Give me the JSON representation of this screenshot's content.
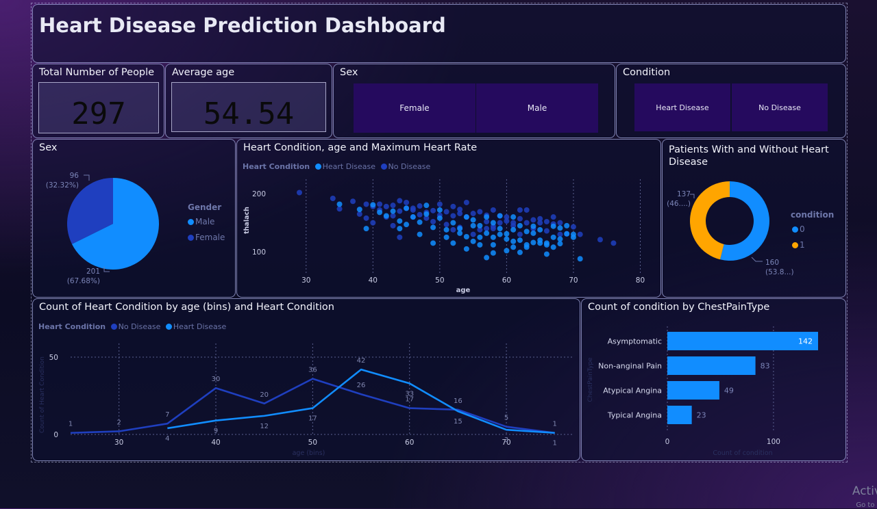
{
  "dashboard": {
    "title": "Heart Disease Prediction Dashboard"
  },
  "kpis": {
    "total_people": {
      "label": "Total Number of People",
      "value": "297"
    },
    "average_age": {
      "label": "Average age",
      "value": "54.54"
    }
  },
  "slicers": {
    "sex": {
      "label": "Sex",
      "options": [
        "Female",
        "Male"
      ]
    },
    "condition": {
      "label": "Condition",
      "options": [
        "Heart Disease",
        "No Disease"
      ]
    }
  },
  "colors": {
    "bright_blue": "#118dff",
    "dark_blue": "#1f3fbf",
    "orange": "#ffa500"
  },
  "watermark": {
    "line1": "Activ",
    "line2": "Go to S"
  },
  "chart_data": [
    {
      "type": "pie",
      "title": "Sex",
      "legend_title": "Gender",
      "legend": [
        "Male",
        "Female"
      ],
      "slices": [
        {
          "name": "Male",
          "value": 201,
          "label": "201",
          "pct": "(67.68%)",
          "color": "#118dff"
        },
        {
          "name": "Female",
          "value": 96,
          "label": "96",
          "pct": "(32.32%)",
          "color": "#1f3fbf"
        }
      ]
    },
    {
      "type": "scatter",
      "title": "Heart Condition, age and Maximum Heart Rate",
      "legend_title": "Heart Condition",
      "legend": [
        "Heart Disease",
        "No Disease"
      ],
      "xlabel": "age",
      "ylabel": "thalach",
      "xlim": [
        25,
        82
      ],
      "ylim": [
        60,
        225
      ],
      "xticks": [
        30,
        40,
        50,
        60,
        70,
        80
      ],
      "yticks": [
        100,
        200
      ],
      "series": [
        {
          "name": "Heart Disease",
          "color": "#118dff",
          "points": [
            [
              35,
              182
            ],
            [
              38,
              173
            ],
            [
              39,
              140
            ],
            [
              40,
              181
            ],
            [
              41,
              168
            ],
            [
              42,
              162
            ],
            [
              43,
              170
            ],
            [
              44,
              153
            ],
            [
              45,
              175
            ],
            [
              46,
              160
            ],
            [
              47,
              151
            ],
            [
              48,
              180
            ],
            [
              49,
              142
            ],
            [
              50,
              158
            ],
            [
              51,
              125
            ],
            [
              52,
              150
            ],
            [
              53,
              140
            ],
            [
              54,
              126
            ],
            [
              55,
              145
            ],
            [
              56,
              125
            ],
            [
              57,
              132
            ],
            [
              58,
              112
            ],
            [
              58,
              150
            ],
            [
              59,
              140
            ],
            [
              60,
              131
            ],
            [
              61,
              118
            ],
            [
              62,
              145
            ],
            [
              63,
              108
            ],
            [
              64,
              132
            ],
            [
              65,
              115
            ],
            [
              66,
              96
            ],
            [
              67,
              125
            ],
            [
              68,
              141
            ],
            [
              69,
              131
            ],
            [
              70,
              125
            ],
            [
              71,
              88
            ],
            [
              57,
              90
            ],
            [
              62,
              99
            ],
            [
              64,
              116
            ],
            [
              68,
              122
            ],
            [
              55,
              155
            ],
            [
              61,
              160
            ],
            [
              54,
              105
            ],
            [
              52,
              115
            ],
            [
              60,
              122
            ],
            [
              66,
              115
            ],
            [
              58,
              125
            ],
            [
              63,
              135
            ],
            [
              56,
              145
            ],
            [
              59,
              162
            ],
            [
              67,
              108
            ],
            [
              65,
              138
            ],
            [
              53,
              132
            ],
            [
              50,
              172
            ],
            [
              49,
              115
            ],
            [
              47,
              130
            ],
            [
              45,
              147
            ],
            [
              61,
              138
            ],
            [
              64,
              144
            ],
            [
              57,
              160
            ],
            [
              62,
              120
            ],
            [
              60,
              102
            ],
            [
              69,
              145
            ],
            [
              70,
              130
            ],
            [
              66,
              112
            ],
            [
              63,
              112
            ],
            [
              58,
              98
            ],
            [
              55,
              118
            ],
            [
              56,
              112
            ],
            [
              59,
              130
            ],
            [
              54,
              160
            ],
            [
              51,
              138
            ],
            [
              48,
              165
            ],
            [
              44,
              140
            ],
            [
              61,
              108
            ],
            [
              67,
              144
            ],
            [
              65,
              120
            ],
            [
              68,
              114
            ]
          ]
        },
        {
          "name": "No Disease",
          "color": "#1f3fbf",
          "points": [
            [
              29,
              202
            ],
            [
              34,
              192
            ],
            [
              35,
              174
            ],
            [
              37,
              187
            ],
            [
              38,
              165
            ],
            [
              39,
              182
            ],
            [
              40,
              178
            ],
            [
              41,
              172
            ],
            [
              42,
              178
            ],
            [
              43,
              162
            ],
            [
              44,
              188
            ],
            [
              45,
              175
            ],
            [
              46,
              172
            ],
            [
              47,
              179
            ],
            [
              48,
              168
            ],
            [
              49,
              171
            ],
            [
              50,
              163
            ],
            [
              51,
              169
            ],
            [
              52,
              162
            ],
            [
              53,
              173
            ],
            [
              54,
              160
            ],
            [
              55,
              166
            ],
            [
              56,
              169
            ],
            [
              57,
              163
            ],
            [
              58,
              172
            ],
            [
              59,
              162
            ],
            [
              60,
              153
            ],
            [
              61,
              150
            ],
            [
              62,
              157
            ],
            [
              63,
              172
            ],
            [
              64,
              155
            ],
            [
              65,
              157
            ],
            [
              66,
              152
            ],
            [
              67,
              148
            ],
            [
              68,
              150
            ],
            [
              69,
              131
            ],
            [
              70,
              143
            ],
            [
              71,
              130
            ],
            [
              74,
              121
            ],
            [
              76,
              115
            ],
            [
              41,
              182
            ],
            [
              42,
              160
            ],
            [
              43,
              180
            ],
            [
              44,
              170
            ],
            [
              45,
              185
            ],
            [
              46,
              160
            ],
            [
              47,
              164
            ],
            [
              48,
              158
            ],
            [
              50,
              182
            ],
            [
              51,
              147
            ],
            [
              52,
              178
            ],
            [
              53,
              142
            ],
            [
              54,
              185
            ],
            [
              56,
              138
            ],
            [
              57,
              140
            ],
            [
              58,
              144
            ],
            [
              59,
              150
            ],
            [
              60,
              160
            ],
            [
              62,
              130
            ],
            [
              63,
              150
            ],
            [
              64,
              140
            ],
            [
              66,
              136
            ],
            [
              67,
              160
            ],
            [
              68,
              130
            ],
            [
              55,
              130
            ],
            [
              52,
              138
            ],
            [
              49,
              152
            ],
            [
              44,
              125
            ],
            [
              39,
              158
            ],
            [
              40,
              150
            ],
            [
              57,
              152
            ],
            [
              53,
              166
            ],
            [
              61,
              145
            ],
            [
              58,
              140
            ],
            [
              65,
              150
            ],
            [
              62,
              172
            ],
            [
              46,
              175
            ],
            [
              43,
              145
            ]
          ]
        }
      ]
    },
    {
      "type": "pie",
      "subtype": "donut",
      "title": "Patients With and Without Heart Disease",
      "legend_title": "condition",
      "legend": [
        "0",
        "1"
      ],
      "slices": [
        {
          "name": "0",
          "value": 160,
          "label": "160",
          "pct": "(53.8...)",
          "color": "#118dff"
        },
        {
          "name": "1",
          "value": 137,
          "label": "137",
          "pct": "(46....)",
          "color": "#ffa500"
        }
      ]
    },
    {
      "type": "line",
      "title": "Count of Heart Condition by age (bins) and Heart Condition",
      "legend_title": "Heart Condition",
      "legend": [
        "No Disease",
        "Heart Disease"
      ],
      "xlabel": "age (bins)",
      "ylabel": "Count of Heart Condition",
      "xlim": [
        25,
        77
      ],
      "ylim": [
        0,
        50
      ],
      "xticks": [
        30,
        40,
        50,
        60,
        70
      ],
      "yticks": [
        0,
        50
      ],
      "series": [
        {
          "name": "No Disease",
          "color": "#1f3fbf",
          "x": [
            25,
            30,
            35,
            40,
            45,
            50,
            55,
            60,
            65,
            70,
            75
          ],
          "y": [
            1,
            2,
            7,
            30,
            20,
            36,
            26,
            17,
            16,
            5,
            1
          ]
        },
        {
          "name": "Heart Disease",
          "color": "#118dff",
          "x": [
            35,
            40,
            45,
            50,
            55,
            60,
            65,
            70,
            75
          ],
          "y": [
            4,
            9,
            12,
            17,
            42,
            33,
            15,
            3,
            1
          ]
        }
      ]
    },
    {
      "type": "bar",
      "orientation": "horizontal",
      "title": "Count of condition by ChestPainType",
      "xlabel": "Count of condition",
      "ylabel": "ChestPainType",
      "categories": [
        "Asymptomatic",
        "Non-anginal Pain",
        "Atypical Angina",
        "Typical Angina"
      ],
      "values": [
        142,
        83,
        49,
        23
      ],
      "xlim": [
        0,
        142
      ],
      "xticks": [
        0,
        100
      ],
      "color": "#118dff"
    }
  ]
}
